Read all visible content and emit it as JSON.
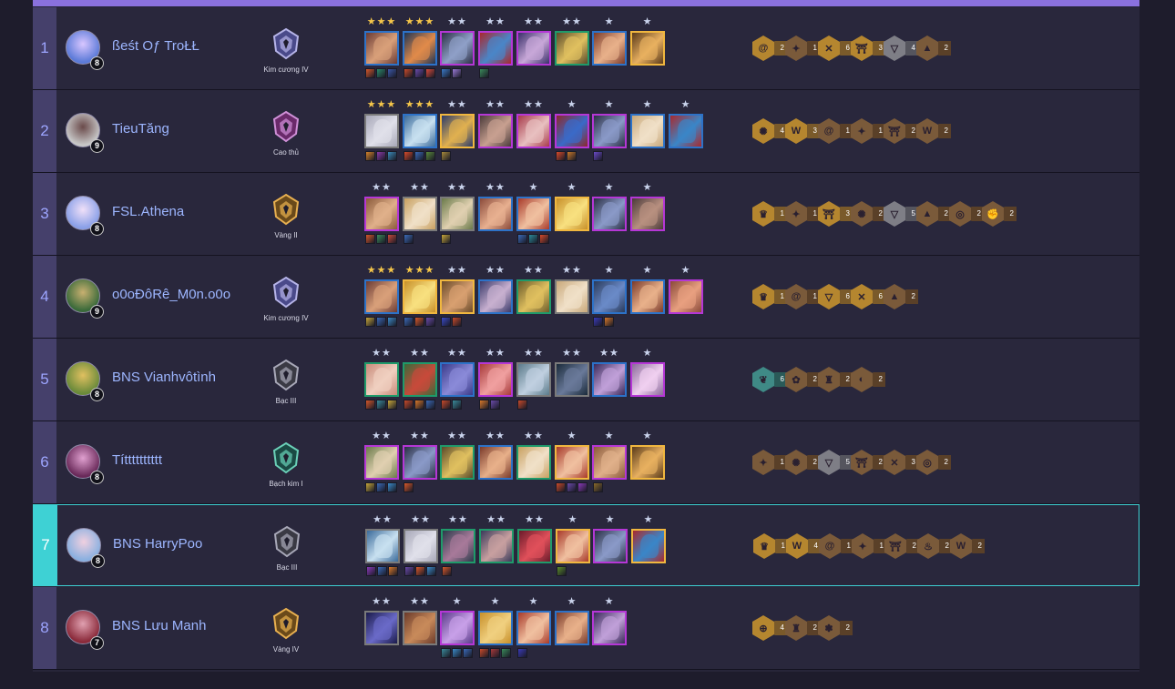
{
  "colors": {
    "accent": "#8a71de",
    "highlight": "#3ed1d4",
    "player_name": "#9db6ff",
    "trait_gold": "#b5862f",
    "trait_bronze": "#7a5a3a",
    "trait_silver": "#7e7e86",
    "trait_teal": "#3f8a86",
    "cost_1": "#7a7a7a",
    "cost_2": "#1f9a6a",
    "cost_3": "#2d72c8",
    "cost_4": "#b537d6",
    "cost_5": "#f0b73f",
    "star_gold": "#f5c64a",
    "star_silver": "#c9d3ec"
  },
  "players": [
    {
      "place": "1",
      "name": "ßeśt Oƒ TroŁŁ",
      "level": "8",
      "rank": "Kim cương IV",
      "rank_tier": "diamond",
      "avatar": [
        "#5b7ad8",
        "#d8c6ff"
      ],
      "units": [
        {
          "cost": 3,
          "stars": 3,
          "art": [
            "#6a3a34",
            "#d9a07a"
          ],
          "items": [
            "#d8582a",
            "#2b8a6a",
            "#3b57a8"
          ]
        },
        {
          "cost": 3,
          "stars": 3,
          "art": [
            "#1f3454",
            "#e08a4a"
          ],
          "items": [
            "#c84a2a",
            "#6a4aa8",
            "#d84a3a"
          ]
        },
        {
          "cost": 4,
          "stars": 2,
          "art": [
            "#2b2f44",
            "#8fa0c8"
          ],
          "items": [
            "#3a7ac8",
            "#9a7ad8"
          ]
        },
        {
          "cost": 4,
          "stars": 2,
          "art": [
            "#a8282e",
            "#4a86c8"
          ],
          "items": [
            "#3a8a5a"
          ]
        },
        {
          "cost": 4,
          "stars": 2,
          "art": [
            "#3a2f6a",
            "#c8a8d8"
          ],
          "items": []
        },
        {
          "cost": 2,
          "stars": 2,
          "art": [
            "#5a4a2a",
            "#e0c060"
          ],
          "items": []
        },
        {
          "cost": 3,
          "stars": 1,
          "art": [
            "#7a3a2a",
            "#e8b08a"
          ],
          "items": []
        },
        {
          "cost": 5,
          "stars": 1,
          "art": [
            "#5a3a1a",
            "#e8b060"
          ],
          "items": []
        }
      ],
      "traits": [
        {
          "icon": "spiral-icon",
          "tier": "gold",
          "count": "2"
        },
        {
          "icon": "shuriken-icon",
          "tier": "bronze",
          "count": "1"
        },
        {
          "icon": "crossed-swords-icon",
          "tier": "gold",
          "count": "6"
        },
        {
          "icon": "torii-gate-icon",
          "tier": "gold",
          "count": "3"
        },
        {
          "icon": "triangle-emblem-icon",
          "tier": "silver",
          "count": "4"
        },
        {
          "icon": "pagoda-icon",
          "tier": "bronze",
          "count": "2"
        }
      ]
    },
    {
      "place": "2",
      "name": "TieuTăng",
      "level": "9",
      "rank": "Cao thủ",
      "rank_tier": "master",
      "avatar": [
        "#c8c8c8",
        "#6a4a4a"
      ],
      "units": [
        {
          "cost": 1,
          "stars": 3,
          "art": [
            "#a8a8b8",
            "#e0e0ea"
          ],
          "items": [
            "#d8842a",
            "#8a3aa8",
            "#3a8ab8"
          ]
        },
        {
          "cost": 3,
          "stars": 3,
          "art": [
            "#3a6a9a",
            "#c8e0f0"
          ],
          "items": [
            "#d84a2a",
            "#3a6ab8",
            "#5a8a3a"
          ]
        },
        {
          "cost": 5,
          "stars": 2,
          "art": [
            "#2a3a6a",
            "#e0b050"
          ],
          "items": [
            "#a88a3a"
          ]
        },
        {
          "cost": 4,
          "stars": 2,
          "art": [
            "#4a3a3a",
            "#c8a090"
          ],
          "items": []
        },
        {
          "cost": 4,
          "stars": 2,
          "art": [
            "#a83a4a",
            "#e8c0c0"
          ],
          "items": []
        },
        {
          "cost": 4,
          "stars": 1,
          "art": [
            "#8a2a2e",
            "#3a6ac8"
          ],
          "items": [
            "#d84a2a",
            "#c8782a"
          ]
        },
        {
          "cost": 4,
          "stars": 1,
          "art": [
            "#2a2f44",
            "#8a9ac8"
          ],
          "items": [
            "#6a4ac8"
          ]
        },
        {
          "cost": 3,
          "stars": 1,
          "art": [
            "#c8a87a",
            "#f0e0c8"
          ],
          "items": []
        },
        {
          "cost": 3,
          "stars": 1,
          "art": [
            "#a82a2e",
            "#3a86c8"
          ],
          "items": []
        }
      ],
      "traits": [
        {
          "icon": "sun-emblem-icon",
          "tier": "gold",
          "count": "4"
        },
        {
          "icon": "wolf-emblem-icon",
          "tier": "gold",
          "count": "3"
        },
        {
          "icon": "spiral-icon",
          "tier": "bronze",
          "count": "1"
        },
        {
          "icon": "shuriken-icon",
          "tier": "bronze",
          "count": "1"
        },
        {
          "icon": "torii-gate-icon",
          "tier": "bronze",
          "count": "2"
        },
        {
          "icon": "crown-wings-icon",
          "tier": "bronze",
          "count": "2"
        }
      ]
    },
    {
      "place": "3",
      "name": "FSL.Athena",
      "level": "8",
      "rank": "Vàng II",
      "rank_tier": "gold",
      "avatar": [
        "#8aa0e8",
        "#f0e0f8"
      ],
      "units": [
        {
          "cost": 4,
          "stars": 2,
          "art": [
            "#8a5a3a",
            "#e0b08a"
          ],
          "items": [
            "#d8582a",
            "#3a8a5a",
            "#c84a3a"
          ]
        },
        {
          "cost": 1,
          "stars": 2,
          "art": [
            "#c8a060",
            "#f0e0c8"
          ],
          "items": [
            "#3a6ab8"
          ]
        },
        {
          "cost": 1,
          "stars": 2,
          "art": [
            "#6a7a4a",
            "#e0d0b0"
          ],
          "items": [
            "#c8a83a"
          ]
        },
        {
          "cost": 3,
          "stars": 2,
          "art": [
            "#8a4a3a",
            "#e8b090"
          ],
          "items": []
        },
        {
          "cost": 3,
          "stars": 1,
          "art": [
            "#a83a2a",
            "#f0c0a0"
          ],
          "items": [
            "#3a6ab8",
            "#2a8a9a",
            "#d84a2a"
          ]
        },
        {
          "cost": 5,
          "stars": 1,
          "art": [
            "#c8902a",
            "#f8e080"
          ],
          "items": []
        },
        {
          "cost": 4,
          "stars": 1,
          "art": [
            "#2a2f44",
            "#8a9ac8"
          ],
          "items": []
        },
        {
          "cost": 4,
          "stars": 1,
          "art": [
            "#4a3a3a",
            "#b89080"
          ],
          "items": []
        }
      ],
      "traits": [
        {
          "icon": "crown-emblem-icon",
          "tier": "gold",
          "count": "1"
        },
        {
          "icon": "shuriken-icon",
          "tier": "bronze",
          "count": "1"
        },
        {
          "icon": "torii-gate-icon",
          "tier": "gold",
          "count": "3"
        },
        {
          "icon": "sun-emblem-icon",
          "tier": "bronze",
          "count": "2"
        },
        {
          "icon": "triangle-emblem-icon",
          "tier": "silver",
          "count": "5"
        },
        {
          "icon": "pagoda-icon",
          "tier": "bronze",
          "count": "2"
        },
        {
          "icon": "target-icon",
          "tier": "bronze",
          "count": "2"
        },
        {
          "icon": "fist-icon",
          "tier": "bronze",
          "count": "2"
        }
      ]
    },
    {
      "place": "4",
      "name": "o0oĐôRê_M0n.o0o",
      "level": "9",
      "rank": "Kim cương IV",
      "rank_tier": "diamond",
      "avatar": [
        "#3a6a3a",
        "#c8b070"
      ],
      "units": [
        {
          "cost": 3,
          "stars": 3,
          "art": [
            "#6a3a34",
            "#d9a07a"
          ],
          "items": [
            "#c8a83a",
            "#3a6ab8",
            "#3a8ac8"
          ]
        },
        {
          "cost": 5,
          "stars": 3,
          "art": [
            "#c8902a",
            "#f8e080"
          ],
          "items": [
            "#3a6ab8",
            "#d8582a",
            "#6a4aa8"
          ]
        },
        {
          "cost": 5,
          "stars": 2,
          "art": [
            "#6a4a2a",
            "#d8a070"
          ],
          "items": [
            "#3a4ac8",
            "#c84a2a"
          ]
        },
        {
          "cost": 3,
          "stars": 2,
          "art": [
            "#3a3a6a",
            "#c8b0d0"
          ],
          "items": []
        },
        {
          "cost": 2,
          "stars": 2,
          "art": [
            "#6a5a2a",
            "#e0c060"
          ],
          "items": []
        },
        {
          "cost": 1,
          "stars": 2,
          "art": [
            "#c8a87a",
            "#f0e0c8"
          ],
          "items": []
        },
        {
          "cost": 3,
          "stars": 1,
          "art": [
            "#2a3a5a",
            "#6a8ac8"
          ],
          "items": [
            "#3a3ab8",
            "#d8782a"
          ]
        },
        {
          "cost": 3,
          "stars": 1,
          "art": [
            "#7a3a2a",
            "#e8b08a"
          ],
          "items": []
        },
        {
          "cost": 4,
          "stars": 1,
          "art": [
            "#8a4a3a",
            "#e8a080"
          ],
          "items": []
        }
      ],
      "traits": [
        {
          "icon": "crown-emblem-icon",
          "tier": "gold",
          "count": "1"
        },
        {
          "icon": "spiral-icon",
          "tier": "bronze",
          "count": "1"
        },
        {
          "icon": "triangle-emblem-icon",
          "tier": "gold",
          "count": "6"
        },
        {
          "icon": "crossed-swords-icon",
          "tier": "gold",
          "count": "6"
        },
        {
          "icon": "pagoda-icon",
          "tier": "bronze",
          "count": "2"
        }
      ]
    },
    {
      "place": "5",
      "name": "BNS Vianhvôtình",
      "level": "8",
      "rank": "Bạc III",
      "rank_tier": "silver",
      "avatar": [
        "#6a8a3a",
        "#e0c060"
      ],
      "units": [
        {
          "cost": 2,
          "stars": 2,
          "art": [
            "#c88a7a",
            "#f0d0c0"
          ],
          "items": [
            "#d8582a",
            "#3a8a9a",
            "#c8a83a"
          ]
        },
        {
          "cost": 2,
          "stars": 2,
          "art": [
            "#3a6a3a",
            "#c84a3a"
          ],
          "items": [
            "#c84a2a",
            "#d8782a",
            "#3a6ab8"
          ]
        },
        {
          "cost": 3,
          "stars": 2,
          "art": [
            "#3a3a8a",
            "#8a8ad8"
          ],
          "items": [
            "#c84a2a",
            "#3a8a9a"
          ]
        },
        {
          "cost": 4,
          "stars": 2,
          "art": [
            "#a83a3a",
            "#f0a0a0"
          ],
          "items": [
            "#d8782a",
            "#6a4aa8"
          ]
        },
        {
          "cost": 1,
          "stars": 2,
          "art": [
            "#5a7a8a",
            "#c0d0e0"
          ],
          "items": [
            "#c84a2a"
          ]
        },
        {
          "cost": 1,
          "stars": 2,
          "art": [
            "#1a2a3a",
            "#6a7a9a"
          ],
          "items": []
        },
        {
          "cost": 3,
          "stars": 2,
          "art": [
            "#3a2a5a",
            "#c0a0d8"
          ],
          "items": []
        },
        {
          "cost": 4,
          "stars": 1,
          "art": [
            "#8a6a9a",
            "#f0d0f0"
          ],
          "items": []
        }
      ],
      "traits": [
        {
          "icon": "leaf-emblem-icon",
          "tier": "teal",
          "count": "6"
        },
        {
          "icon": "lotus-icon",
          "tier": "bronze",
          "count": "2"
        },
        {
          "icon": "lantern-icon",
          "tier": "bronze",
          "count": "2"
        },
        {
          "icon": "helmet-icon",
          "tier": "bronze",
          "count": "2"
        }
      ]
    },
    {
      "place": "6",
      "name": "Títttttttttt",
      "level": "8",
      "rank": "Bạch kim I",
      "rank_tier": "platinum",
      "avatar": [
        "#6a2a5a",
        "#e0a0d0"
      ],
      "units": [
        {
          "cost": 4,
          "stars": 2,
          "art": [
            "#6a7a4a",
            "#e0d0b0"
          ],
          "items": [
            "#c8a83a",
            "#3a6ab8",
            "#3a8ac8"
          ]
        },
        {
          "cost": 4,
          "stars": 2,
          "art": [
            "#2a2f44",
            "#8a9ac8"
          ],
          "items": [
            "#d8582a"
          ]
        },
        {
          "cost": 2,
          "stars": 2,
          "art": [
            "#5a4a2a",
            "#e0c060"
          ],
          "items": []
        },
        {
          "cost": 3,
          "stars": 2,
          "art": [
            "#7a3a2a",
            "#e8b08a"
          ],
          "items": []
        },
        {
          "cost": 2,
          "stars": 2,
          "art": [
            "#c8a060",
            "#f0e0c8"
          ],
          "items": []
        },
        {
          "cost": 5,
          "stars": 1,
          "art": [
            "#a83a2a",
            "#f0c0a0"
          ],
          "items": [
            "#c84a2a",
            "#6a4aa8",
            "#8a3ab8"
          ]
        },
        {
          "cost": 4,
          "stars": 1,
          "art": [
            "#8a5a3a",
            "#e0b08a"
          ],
          "items": [
            "#8a6a2a"
          ]
        },
        {
          "cost": 5,
          "stars": 1,
          "art": [
            "#5a3a1a",
            "#e8b060"
          ],
          "items": []
        }
      ],
      "traits": [
        {
          "icon": "shuriken-icon",
          "tier": "bronze",
          "count": "1"
        },
        {
          "icon": "sun-emblem-icon",
          "tier": "bronze",
          "count": "2"
        },
        {
          "icon": "triangle-emblem-icon",
          "tier": "silver",
          "count": "5"
        },
        {
          "icon": "torii-gate-icon",
          "tier": "bronze",
          "count": "2"
        },
        {
          "icon": "crossed-swords-icon",
          "tier": "bronze",
          "count": "3"
        },
        {
          "icon": "target-icon",
          "tier": "bronze",
          "count": "2"
        }
      ]
    },
    {
      "place": "7",
      "name": "BNS HarryPoo",
      "level": "8",
      "rank": "Bạc III",
      "rank_tier": "silver",
      "avatar": [
        "#8ab0e0",
        "#f0d0e0"
      ],
      "units": [
        {
          "cost": 1,
          "stars": 2,
          "art": [
            "#3a6a9a",
            "#c8e0f0"
          ],
          "items": [
            "#8a3ab8",
            "#3a6ab8",
            "#d8782a"
          ]
        },
        {
          "cost": 1,
          "stars": 2,
          "art": [
            "#a8a8b8",
            "#e0e0ea"
          ],
          "items": [
            "#6a4aa8",
            "#d8582a",
            "#3a8ac8"
          ]
        },
        {
          "cost": 2,
          "stars": 2,
          "art": [
            "#2a3a4a",
            "#a87a9a"
          ],
          "items": [
            "#d8582a"
          ]
        },
        {
          "cost": 2,
          "stars": 2,
          "art": [
            "#3a3a5a",
            "#c8a0a0"
          ],
          "items": []
        },
        {
          "cost": 2,
          "stars": 2,
          "art": [
            "#6a1a2a",
            "#e0505a"
          ],
          "items": []
        },
        {
          "cost": 5,
          "stars": 1,
          "art": [
            "#a83a2a",
            "#f0c0a0"
          ],
          "items": [
            "#5a8a2a"
          ]
        },
        {
          "cost": 4,
          "stars": 1,
          "art": [
            "#2a2f44",
            "#8a9ac8"
          ],
          "items": []
        },
        {
          "cost": 5,
          "stars": 1,
          "art": [
            "#a82a2e",
            "#3a86c8"
          ],
          "items": []
        }
      ],
      "traits": [
        {
          "icon": "crown-emblem-icon",
          "tier": "gold",
          "count": "1"
        },
        {
          "icon": "wolf-emblem-icon",
          "tier": "gold",
          "count": "4"
        },
        {
          "icon": "spiral-icon",
          "tier": "bronze",
          "count": "1"
        },
        {
          "icon": "shuriken-icon",
          "tier": "bronze",
          "count": "1"
        },
        {
          "icon": "torii-gate-icon",
          "tier": "bronze",
          "count": "2"
        },
        {
          "icon": "flame-icon",
          "tier": "bronze",
          "count": "2"
        },
        {
          "icon": "crown-wings-icon",
          "tier": "bronze",
          "count": "2"
        }
      ]
    },
    {
      "place": "8",
      "name": "BNS Lưu Manh",
      "level": "7",
      "rank": "Vàng IV",
      "rank_tier": "gold",
      "avatar": [
        "#8a2a3a",
        "#e0a0b0"
      ],
      "units": [
        {
          "cost": 1,
          "stars": 2,
          "art": [
            "#1a1a4a",
            "#6a6ac8"
          ],
          "items": []
        },
        {
          "cost": 1,
          "stars": 2,
          "art": [
            "#6a3a2a",
            "#c88a5a"
          ],
          "items": []
        },
        {
          "cost": 4,
          "stars": 1,
          "art": [
            "#5a3a8a",
            "#c8a0e8"
          ],
          "items": [
            "#3a8a9a",
            "#3a8ac8",
            "#3a6ab8"
          ]
        },
        {
          "cost": 3,
          "stars": 1,
          "art": [
            "#c8902a",
            "#f0d080"
          ],
          "items": [
            "#c84a2a",
            "#a83a3a",
            "#3a8a5a"
          ]
        },
        {
          "cost": 3,
          "stars": 1,
          "art": [
            "#a83a2a",
            "#f0c0a0"
          ],
          "items": [
            "#3a3ab8"
          ]
        },
        {
          "cost": 3,
          "stars": 1,
          "art": [
            "#7a3a2a",
            "#e8b08a"
          ],
          "items": []
        },
        {
          "cost": 4,
          "stars": 1,
          "art": [
            "#3a2a5a",
            "#c0a0d8"
          ],
          "items": []
        }
      ],
      "traits": [
        {
          "icon": "crosshair-icon",
          "tier": "gold",
          "count": "4"
        },
        {
          "icon": "lantern-icon",
          "tier": "bronze",
          "count": "2"
        },
        {
          "icon": "fan-icon",
          "tier": "bronze",
          "count": "2"
        }
      ]
    }
  ]
}
